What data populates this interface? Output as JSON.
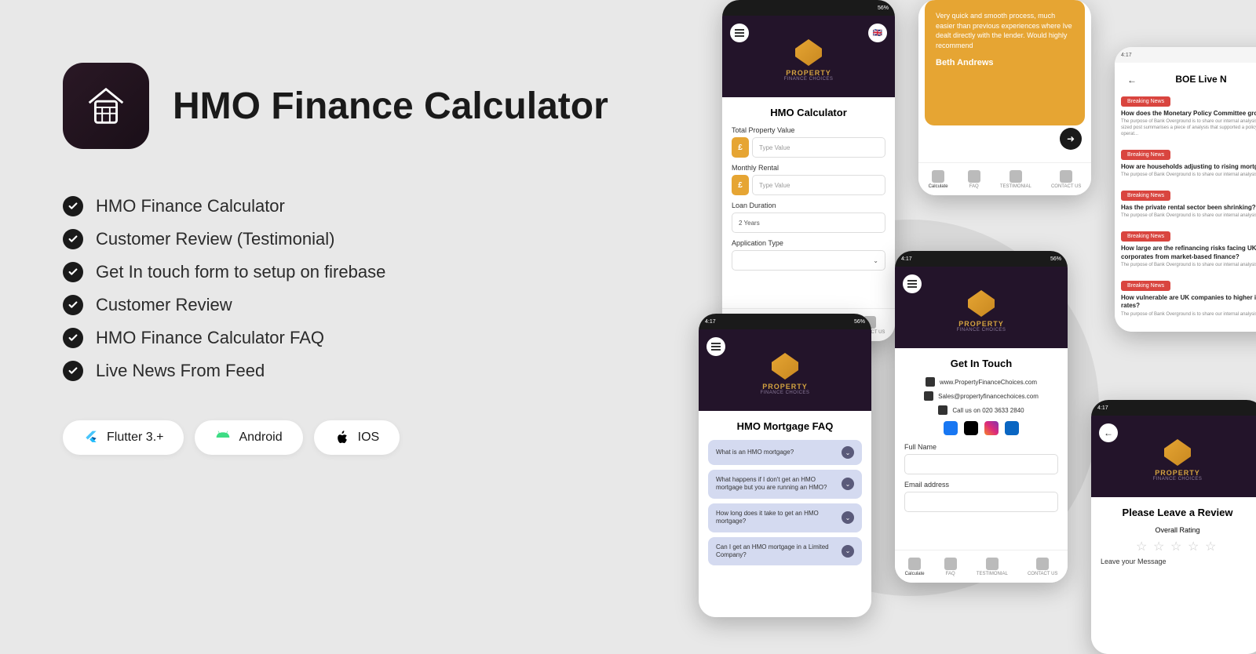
{
  "title": "HMO Finance Calculator",
  "features": [
    "HMO Finance Calculator",
    "Customer Review (Testimonial)",
    "Get In touch form to setup on firebase",
    "Customer Review",
    "HMO Finance Calculator FAQ",
    "Live News From Feed"
  ],
  "chips": [
    {
      "label": "Flutter 3.+",
      "icon": "flutter"
    },
    {
      "label": "Android",
      "icon": "android"
    },
    {
      "label": "IOS",
      "icon": "ios"
    }
  ],
  "brand": {
    "name": "PROPERTY",
    "sub": "FINANCE CHOICES"
  },
  "status": {
    "time": "4:17",
    "indicators": "56%"
  },
  "calc": {
    "title": "HMO Calculator",
    "prop_label": "Total Property Value",
    "rent_label": "Monthly Rental",
    "duration_label": "Loan Duration",
    "duration_value": "2 Years",
    "type_label": "Application Type",
    "placeholder": "Type Value",
    "currency": "£"
  },
  "nav": {
    "items": [
      "Calculate",
      "FAQ",
      "TESTIMONIAL",
      "CONTACT US"
    ]
  },
  "testimonial": {
    "text": "Very quick and smooth process, much easier than previous experiences where Ive dealt directly with the lender. Would highly recommend",
    "name": "Beth Andrews"
  },
  "news": {
    "title": "BOE Live N",
    "badge": "Breaking News",
    "items": [
      {
        "title": "How does the Monetary Policy Committee growth?",
        "desc": "The purpose of Bank Overground is to share our internal analysis. Each bite-sized post summarises a piece of analysis that supported a policy or operat..."
      },
      {
        "title": "How are households adjusting to rising mortg",
        "desc": "The purpose of Bank Overground is to share our internal analysis..."
      },
      {
        "title": "Has the private rental sector been shrinking?",
        "desc": "The purpose of Bank Overground is to share our internal analysis..."
      },
      {
        "title": "How large are the refinancing risks facing UK corporates from market-based finance?",
        "desc": "The purpose of Bank Overground is to share our internal analysis..."
      },
      {
        "title": "How vulnerable are UK companies to higher interest rates?",
        "desc": "The purpose of Bank Overground is to share our internal analysis..."
      }
    ]
  },
  "faq": {
    "title": "HMO Mortgage FAQ",
    "items": [
      "What is an HMO mortgage?",
      "What happens if I don't get an HMO mortgage but you are running an HMO?",
      "How long does it take to get an HMO mortgage?",
      "Can I get an HMO mortgage in a Limited Company?"
    ]
  },
  "contact": {
    "title": "Get In Touch",
    "web": "www.PropertyFinanceChoices.com",
    "email": "Sales@propertyfinancechoices.com",
    "phone": "Call us on 020 3633 2840",
    "name_label": "Full Name",
    "email_label": "Email address"
  },
  "review": {
    "title": "Please Leave a Review",
    "rating_label": "Overall Rating",
    "msg_label": "Leave your Message"
  }
}
